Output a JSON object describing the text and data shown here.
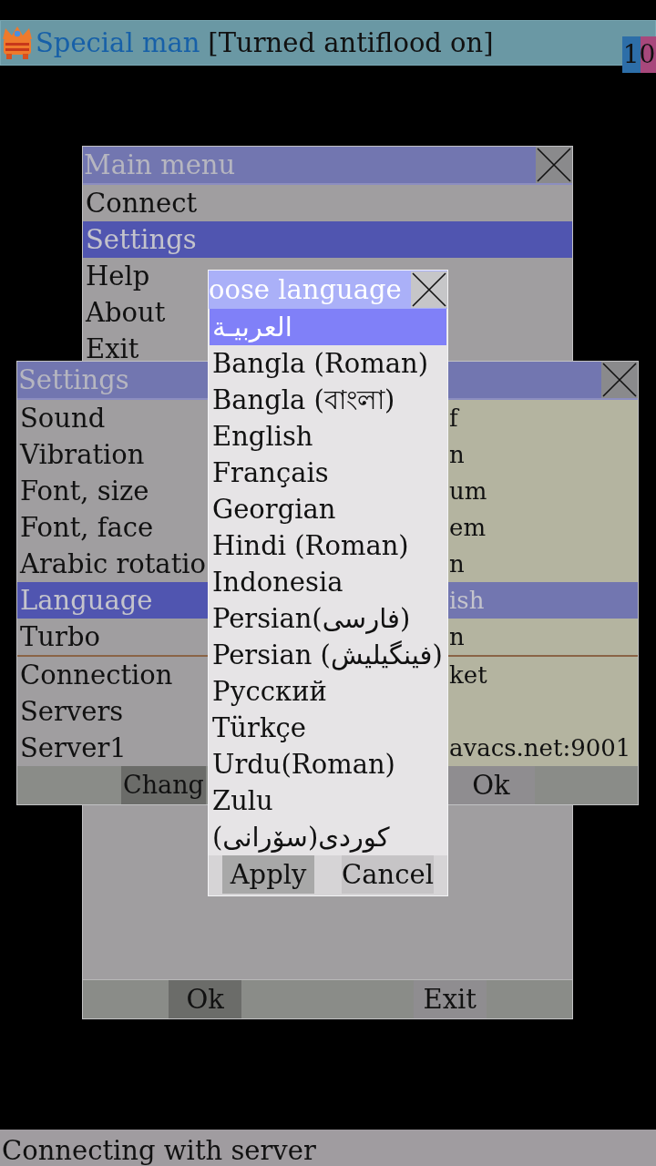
{
  "header": {
    "user": "Special man",
    "message": "[Turned antiflood on]",
    "count": "10"
  },
  "main_menu": {
    "title": "Main menu",
    "items": [
      {
        "label": "Connect",
        "selected": false
      },
      {
        "label": "Settings",
        "selected": true
      },
      {
        "label": "Help",
        "selected": false
      },
      {
        "label": "About",
        "selected": false
      },
      {
        "label": "Exit",
        "selected": false
      }
    ],
    "buttons": [
      {
        "label": "Ok",
        "selected": true
      },
      {
        "label": "Exit",
        "selected": false
      }
    ]
  },
  "settings": {
    "title": "Settings",
    "sections": [
      {
        "rows": [
          {
            "label": "Sound",
            "value": "f",
            "selected": false
          },
          {
            "label": "Vibration",
            "value": "n",
            "selected": false
          },
          {
            "label": "Font, size",
            "value": "um",
            "selected": false
          },
          {
            "label": "Font, face",
            "value": "em",
            "selected": false
          },
          {
            "label": "Arabic rotatio",
            "value": "n",
            "selected": false
          },
          {
            "label": "Language",
            "value": "ish",
            "selected": true
          },
          {
            "label": "Turbo",
            "value": "n",
            "selected": false
          }
        ]
      },
      {
        "rows": [
          {
            "label": "Connection",
            "value": "ket",
            "selected": false
          },
          {
            "label": "Servers",
            "selected": false
          },
          {
            "label": "Server1",
            "value": "avacs.net:9001",
            "selected": false
          }
        ]
      }
    ],
    "buttons": [
      {
        "label": "Chang",
        "selected": true
      },
      {
        "label": "Ok",
        "selected": false
      }
    ]
  },
  "language_dialog": {
    "title": "oose language",
    "languages": [
      {
        "label": "العربيـة",
        "selected": true
      },
      {
        "label": "Bangla (Roman)",
        "selected": false
      },
      {
        "label": "Bangla (বাংলা)",
        "selected": false
      },
      {
        "label": "English",
        "selected": false
      },
      {
        "label": "Français",
        "selected": false
      },
      {
        "label": "Georgian",
        "selected": false
      },
      {
        "label": "Hindi (Roman)",
        "selected": false
      },
      {
        "label": "Indonesia",
        "selected": false
      },
      {
        "label": "Persian(فارسی)",
        "selected": false
      },
      {
        "label": "Persian (فینگیلیش)",
        "selected": false
      },
      {
        "label": "Русский",
        "selected": false
      },
      {
        "label": "Türkçe",
        "selected": false
      },
      {
        "label": "Urdu(Roman)",
        "selected": false
      },
      {
        "label": "Zulu",
        "selected": false
      },
      {
        "label": "کوردی(سۆرانی)",
        "selected": false
      }
    ],
    "buttons": [
      {
        "label": "Apply",
        "selected": true
      },
      {
        "label": "Cancel",
        "selected": false
      }
    ]
  },
  "status_bar": {
    "text": "Connecting with server"
  }
}
